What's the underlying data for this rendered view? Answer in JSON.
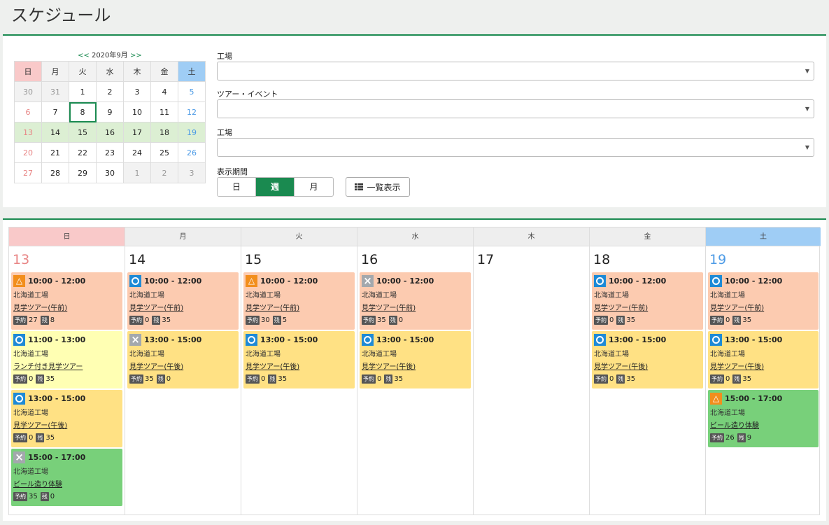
{
  "page_title": "スケジュール",
  "mini_calendar": {
    "prev": "<<",
    "next": ">>",
    "month_label": "2020年9月",
    "weekdays": [
      "日",
      "月",
      "火",
      "水",
      "木",
      "金",
      "土"
    ],
    "weeks": [
      [
        "30",
        "31",
        "1",
        "2",
        "3",
        "4",
        "5"
      ],
      [
        "6",
        "7",
        "8",
        "9",
        "10",
        "11",
        "12"
      ],
      [
        "13",
        "14",
        "15",
        "16",
        "17",
        "18",
        "19"
      ],
      [
        "20",
        "21",
        "22",
        "23",
        "24",
        "25",
        "26"
      ],
      [
        "27",
        "28",
        "29",
        "30",
        "1",
        "2",
        "3"
      ]
    ],
    "today": "8",
    "selected_week_index": 2
  },
  "filters": {
    "factory_label_1": "工場",
    "tour_label": "ツアー・イベント",
    "factory_label_2": "工場",
    "period_label": "表示期間",
    "period_options": [
      "日",
      "週",
      "月"
    ],
    "period_selected": "週",
    "list_button": "一覧表示"
  },
  "week": {
    "days": [
      {
        "dow": "日",
        "date": "13",
        "events": [
          {
            "status": "triangle",
            "time": "10:00 - 12:00",
            "place": "北海道工場",
            "name": "見学ツアー(午前)",
            "reserved": "27",
            "remain": "8",
            "color": "salmon"
          },
          {
            "status": "circle",
            "time": "11:00 - 13:00",
            "place": "北海道工場",
            "name": "ランチ付き見学ツアー",
            "reserved": "0",
            "remain": "35",
            "color": "lyellow"
          },
          {
            "status": "circle",
            "time": "13:00 - 15:00",
            "place": "北海道工場",
            "name": "見学ツアー(午後)",
            "reserved": "0",
            "remain": "35",
            "color": "yellow"
          },
          {
            "status": "cross",
            "time": "15:00 - 17:00",
            "place": "北海道工場",
            "name": "ビール造り体験",
            "reserved": "35",
            "remain": "0",
            "color": "green"
          }
        ]
      },
      {
        "dow": "月",
        "date": "14",
        "events": [
          {
            "status": "circle",
            "time": "10:00 - 12:00",
            "place": "北海道工場",
            "name": "見学ツアー(午前)",
            "reserved": "0",
            "remain": "35",
            "color": "salmon"
          },
          {
            "status": "cross",
            "time": "13:00 - 15:00",
            "place": "北海道工場",
            "name": "見学ツアー(午後)",
            "reserved": "35",
            "remain": "0",
            "color": "yellow"
          }
        ]
      },
      {
        "dow": "火",
        "date": "15",
        "events": [
          {
            "status": "triangle",
            "time": "10:00 - 12:00",
            "place": "北海道工場",
            "name": "見学ツアー(午前)",
            "reserved": "30",
            "remain": "5",
            "color": "salmon"
          },
          {
            "status": "circle",
            "time": "13:00 - 15:00",
            "place": "北海道工場",
            "name": "見学ツアー(午後)",
            "reserved": "0",
            "remain": "35",
            "color": "yellow"
          }
        ]
      },
      {
        "dow": "水",
        "date": "16",
        "events": [
          {
            "status": "cross",
            "time": "10:00 - 12:00",
            "place": "北海道工場",
            "name": "見学ツアー(午前)",
            "reserved": "35",
            "remain": "0",
            "color": "salmon"
          },
          {
            "status": "circle",
            "time": "13:00 - 15:00",
            "place": "北海道工場",
            "name": "見学ツアー(午後)",
            "reserved": "0",
            "remain": "35",
            "color": "yellow"
          }
        ]
      },
      {
        "dow": "木",
        "date": "17",
        "events": []
      },
      {
        "dow": "金",
        "date": "18",
        "events": [
          {
            "status": "circle",
            "time": "10:00 - 12:00",
            "place": "北海道工場",
            "name": "見学ツアー(午前)",
            "reserved": "0",
            "remain": "35",
            "color": "salmon"
          },
          {
            "status": "circle",
            "time": "13:00 - 15:00",
            "place": "北海道工場",
            "name": "見学ツアー(午後)",
            "reserved": "0",
            "remain": "35",
            "color": "yellow"
          }
        ]
      },
      {
        "dow": "土",
        "date": "19",
        "events": [
          {
            "status": "circle",
            "time": "10:00 - 12:00",
            "place": "北海道工場",
            "name": "見学ツアー(午前)",
            "reserved": "0",
            "remain": "35",
            "color": "salmon"
          },
          {
            "status": "circle",
            "time": "13:00 - 15:00",
            "place": "北海道工場",
            "name": "見学ツアー(午後)",
            "reserved": "0",
            "remain": "35",
            "color": "yellow"
          },
          {
            "status": "triangle",
            "time": "15:00 - 17:00",
            "place": "北海道工場",
            "name": "ビール造り体験",
            "reserved": "26",
            "remain": "9",
            "color": "green"
          }
        ]
      }
    ],
    "reserved_badge": "予約",
    "remain_badge": "残"
  },
  "colors": {
    "accent": "#1a8a50",
    "sunday": "#f9c9c9",
    "saturday": "#9fcdf5"
  }
}
